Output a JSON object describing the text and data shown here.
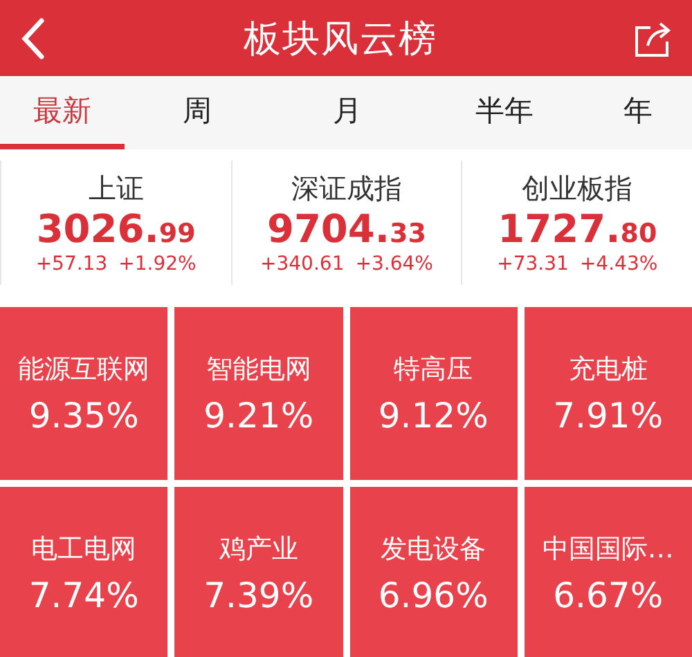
{
  "header": {
    "title": "板块风云榜"
  },
  "tabs": [
    {
      "label": "最新",
      "selected": true
    },
    {
      "label": "周",
      "selected": false
    },
    {
      "label": "月",
      "selected": false
    },
    {
      "label": "半年",
      "selected": false
    },
    {
      "label": "年",
      "selected": false
    }
  ],
  "indices": [
    {
      "name": "上证",
      "value_main": "3026.",
      "value_decimals": "99",
      "change": "+57.13",
      "change_pct": "+1.92%"
    },
    {
      "name": "深证成指",
      "value_main": "9704.",
      "value_decimals": "33",
      "change": "+340.61",
      "change_pct": "+3.64%"
    },
    {
      "name": "创业板指",
      "value_main": "1727.",
      "value_decimals": "80",
      "change": "+73.31",
      "change_pct": "+4.43%"
    }
  ],
  "sectors": [
    {
      "name": "能源互联网",
      "change_pct": "9.35%"
    },
    {
      "name": "智能电网",
      "change_pct": "9.21%"
    },
    {
      "name": "特高压",
      "change_pct": "9.12%"
    },
    {
      "name": "充电桩",
      "change_pct": "7.91%"
    },
    {
      "name": "电工电网",
      "change_pct": "7.74%"
    },
    {
      "name": "鸡产业",
      "change_pct": "7.39%"
    },
    {
      "name": "发电设备",
      "change_pct": "6.96%"
    },
    {
      "name": "中国国际…",
      "change_pct": "6.67%"
    }
  ]
}
